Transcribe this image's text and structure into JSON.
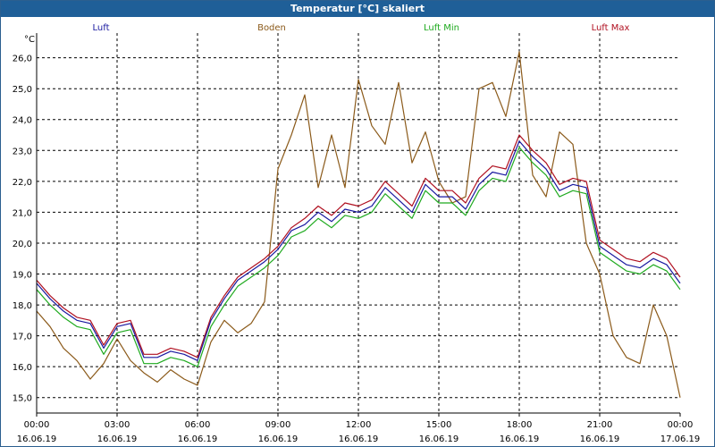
{
  "window": {
    "title": "Temperatur [°C] skaliert"
  },
  "chart_data": {
    "type": "line",
    "title": "Temperatur [°C] skaliert",
    "ylabel": "°C",
    "xlabel": "",
    "ylim": [
      14.5,
      26.8
    ],
    "xlim": [
      0,
      24
    ],
    "grid": true,
    "legend_position": "top",
    "yticks": [
      15.0,
      16.0,
      17.0,
      18.0,
      19.0,
      20.0,
      21.0,
      22.0,
      23.0,
      24.0,
      25.0,
      26.0
    ],
    "ytick_labels": [
      "15,0",
      "16,0",
      "17,0",
      "18,0",
      "19,0",
      "20,0",
      "21,0",
      "22,0",
      "23,0",
      "24,0",
      "25,0",
      "26,0"
    ],
    "xticks": [
      0,
      3,
      6,
      9,
      12,
      15,
      18,
      21,
      24
    ],
    "xtick_labels": [
      {
        "time": "00:00",
        "date": "16.06.19"
      },
      {
        "time": "03:00",
        "date": "16.06.19"
      },
      {
        "time": "06:00",
        "date": "16.06.19"
      },
      {
        "time": "09:00",
        "date": "16.06.19"
      },
      {
        "time": "12:00",
        "date": "16.06.19"
      },
      {
        "time": "15:00",
        "date": "16.06.19"
      },
      {
        "time": "18:00",
        "date": "16.06.19"
      },
      {
        "time": "21:00",
        "date": "16.06.19"
      },
      {
        "time": "00:00",
        "date": "17.06.19"
      }
    ],
    "series": [
      {
        "name": "Luft",
        "color": "#1a1aa0",
        "points": [
          [
            0,
            18.7
          ],
          [
            0.5,
            18.2
          ],
          [
            1,
            17.8
          ],
          [
            1.5,
            17.5
          ],
          [
            2,
            17.4
          ],
          [
            2.5,
            16.6
          ],
          [
            3,
            17.3
          ],
          [
            3.5,
            17.4
          ],
          [
            4,
            16.3
          ],
          [
            4.5,
            16.3
          ],
          [
            5,
            16.5
          ],
          [
            5.5,
            16.4
          ],
          [
            6,
            16.2
          ],
          [
            6.5,
            17.5
          ],
          [
            7,
            18.2
          ],
          [
            7.5,
            18.8
          ],
          [
            8,
            19.1
          ],
          [
            8.5,
            19.4
          ],
          [
            9,
            19.8
          ],
          [
            9.5,
            20.4
          ],
          [
            10,
            20.6
          ],
          [
            10.5,
            21.0
          ],
          [
            11,
            20.7
          ],
          [
            11.5,
            21.1
          ],
          [
            12,
            21.0
          ],
          [
            12.5,
            21.2
          ],
          [
            13,
            21.8
          ],
          [
            13.5,
            21.4
          ],
          [
            14,
            21.0
          ],
          [
            14.5,
            21.9
          ],
          [
            15,
            21.5
          ],
          [
            15.5,
            21.5
          ],
          [
            16,
            21.1
          ],
          [
            16.5,
            21.9
          ],
          [
            17,
            22.3
          ],
          [
            17.5,
            22.2
          ],
          [
            18,
            23.3
          ],
          [
            18.5,
            22.8
          ],
          [
            19,
            22.4
          ],
          [
            19.5,
            21.7
          ],
          [
            20,
            21.9
          ],
          [
            20.5,
            21.8
          ],
          [
            21,
            19.9
          ],
          [
            21.5,
            19.6
          ],
          [
            22,
            19.3
          ],
          [
            22.5,
            19.2
          ],
          [
            23,
            19.5
          ],
          [
            23.5,
            19.3
          ],
          [
            24,
            18.7
          ]
        ]
      },
      {
        "name": "Boden",
        "color": "#8b5a1a",
        "points": [
          [
            0,
            17.8
          ],
          [
            0.5,
            17.3
          ],
          [
            1,
            16.6
          ],
          [
            1.5,
            16.2
          ],
          [
            2,
            15.6
          ],
          [
            2.5,
            16.1
          ],
          [
            3,
            16.9
          ],
          [
            3.5,
            16.2
          ],
          [
            4,
            15.8
          ],
          [
            4.5,
            15.5
          ],
          [
            5,
            15.9
          ],
          [
            5.5,
            15.6
          ],
          [
            6,
            15.4
          ],
          [
            6.5,
            16.8
          ],
          [
            7,
            17.5
          ],
          [
            7.5,
            17.1
          ],
          [
            8,
            17.4
          ],
          [
            8.5,
            18.1
          ],
          [
            9,
            22.4
          ],
          [
            9.5,
            23.5
          ],
          [
            10,
            24.8
          ],
          [
            10.5,
            21.8
          ],
          [
            11,
            23.5
          ],
          [
            11.5,
            21.8
          ],
          [
            12,
            25.3
          ],
          [
            12.5,
            23.8
          ],
          [
            13,
            23.2
          ],
          [
            13.5,
            25.2
          ],
          [
            14,
            22.6
          ],
          [
            14.5,
            23.6
          ],
          [
            15,
            22.0
          ],
          [
            15.5,
            21.3
          ],
          [
            16,
            21.5
          ],
          [
            16.5,
            25.0
          ],
          [
            17,
            25.2
          ],
          [
            17.5,
            24.1
          ],
          [
            18,
            26.2
          ],
          [
            18.5,
            22.2
          ],
          [
            19,
            21.5
          ],
          [
            19.5,
            23.6
          ],
          [
            20,
            23.2
          ],
          [
            20.5,
            20.0
          ],
          [
            21,
            19.0
          ],
          [
            21.5,
            17.0
          ],
          [
            22,
            16.3
          ],
          [
            22.5,
            16.1
          ],
          [
            23,
            18.0
          ],
          [
            23.5,
            17.0
          ],
          [
            24,
            15.0
          ]
        ]
      },
      {
        "name": "Luft Min",
        "color": "#1faa1f",
        "points": [
          [
            0,
            18.5
          ],
          [
            0.5,
            18.0
          ],
          [
            1,
            17.6
          ],
          [
            1.5,
            17.3
          ],
          [
            2,
            17.2
          ],
          [
            2.5,
            16.4
          ],
          [
            3,
            17.1
          ],
          [
            3.5,
            17.2
          ],
          [
            4,
            16.1
          ],
          [
            4.5,
            16.1
          ],
          [
            5,
            16.3
          ],
          [
            5.5,
            16.2
          ],
          [
            6,
            16.0
          ],
          [
            6.5,
            17.3
          ],
          [
            7,
            18.0
          ],
          [
            7.5,
            18.6
          ],
          [
            8,
            18.9
          ],
          [
            8.5,
            19.2
          ],
          [
            9,
            19.6
          ],
          [
            9.5,
            20.2
          ],
          [
            10,
            20.4
          ],
          [
            10.5,
            20.8
          ],
          [
            11,
            20.5
          ],
          [
            11.5,
            20.9
          ],
          [
            12,
            20.8
          ],
          [
            12.5,
            21.0
          ],
          [
            13,
            21.6
          ],
          [
            13.5,
            21.2
          ],
          [
            14,
            20.8
          ],
          [
            14.5,
            21.7
          ],
          [
            15,
            21.3
          ],
          [
            15.5,
            21.3
          ],
          [
            16,
            20.9
          ],
          [
            16.5,
            21.7
          ],
          [
            17,
            22.1
          ],
          [
            17.5,
            22.0
          ],
          [
            18,
            23.1
          ],
          [
            18.5,
            22.6
          ],
          [
            19,
            22.2
          ],
          [
            19.5,
            21.5
          ],
          [
            20,
            21.7
          ],
          [
            20.5,
            21.6
          ],
          [
            21,
            19.7
          ],
          [
            21.5,
            19.4
          ],
          [
            22,
            19.1
          ],
          [
            22.5,
            19.0
          ],
          [
            23,
            19.3
          ],
          [
            23.5,
            19.1
          ],
          [
            24,
            18.5
          ]
        ]
      },
      {
        "name": "Luft Max",
        "color": "#b01020",
        "points": [
          [
            0,
            18.8
          ],
          [
            0.5,
            18.3
          ],
          [
            1,
            17.9
          ],
          [
            1.5,
            17.6
          ],
          [
            2,
            17.5
          ],
          [
            2.5,
            16.7
          ],
          [
            3,
            17.4
          ],
          [
            3.5,
            17.5
          ],
          [
            4,
            16.4
          ],
          [
            4.5,
            16.4
          ],
          [
            5,
            16.6
          ],
          [
            5.5,
            16.5
          ],
          [
            6,
            16.3
          ],
          [
            6.5,
            17.6
          ],
          [
            7,
            18.3
          ],
          [
            7.5,
            18.9
          ],
          [
            8,
            19.2
          ],
          [
            8.5,
            19.5
          ],
          [
            9,
            19.9
          ],
          [
            9.5,
            20.5
          ],
          [
            10,
            20.8
          ],
          [
            10.5,
            21.2
          ],
          [
            11,
            20.9
          ],
          [
            11.5,
            21.3
          ],
          [
            12,
            21.2
          ],
          [
            12.5,
            21.4
          ],
          [
            13,
            22.0
          ],
          [
            13.5,
            21.6
          ],
          [
            14,
            21.2
          ],
          [
            14.5,
            22.1
          ],
          [
            15,
            21.7
          ],
          [
            15.5,
            21.7
          ],
          [
            16,
            21.3
          ],
          [
            16.5,
            22.1
          ],
          [
            17,
            22.5
          ],
          [
            17.5,
            22.4
          ],
          [
            18,
            23.5
          ],
          [
            18.5,
            23.0
          ],
          [
            19,
            22.6
          ],
          [
            19.5,
            21.9
          ],
          [
            20,
            22.1
          ],
          [
            20.5,
            22.0
          ],
          [
            21,
            20.1
          ],
          [
            21.5,
            19.8
          ],
          [
            22,
            19.5
          ],
          [
            22.5,
            19.4
          ],
          [
            23,
            19.7
          ],
          [
            23.5,
            19.5
          ],
          [
            24,
            18.9
          ]
        ]
      }
    ]
  }
}
